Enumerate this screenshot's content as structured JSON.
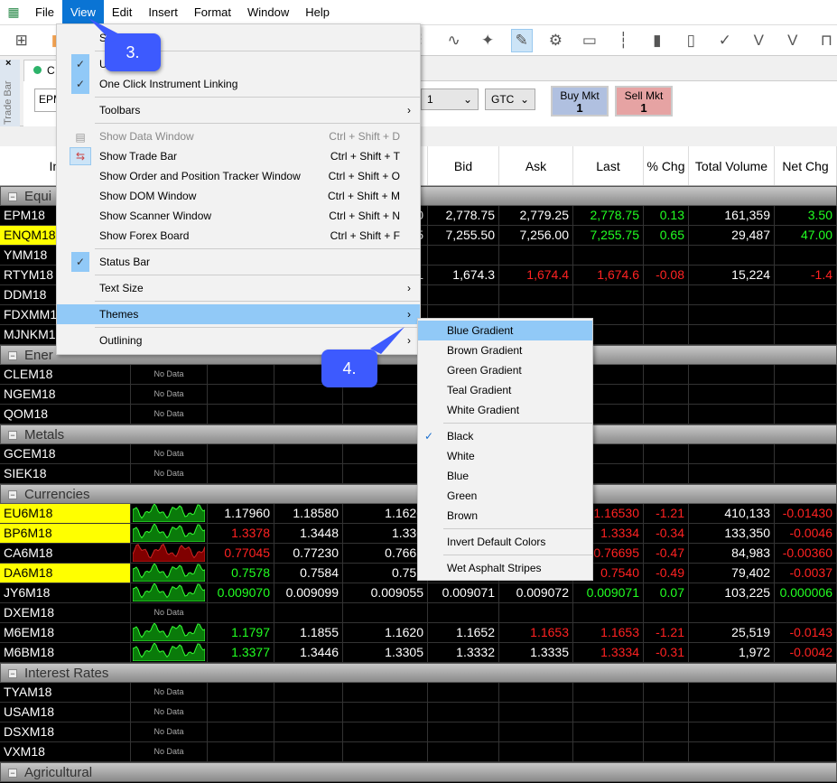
{
  "menubar": {
    "items": [
      "File",
      "View",
      "Edit",
      "Insert",
      "Format",
      "Window",
      "Help"
    ],
    "active": "View"
  },
  "tradebar": {
    "vertical_label": "Trade Bar",
    "tab_label": "C",
    "instrument": "EPM",
    "qty": "1",
    "tif": "GTC",
    "buy": {
      "label": "Buy Mkt",
      "qty": "1"
    },
    "sell": {
      "label": "Sell Mkt",
      "qty": "1"
    }
  },
  "columns": [
    "Instru",
    "",
    "",
    "",
    "",
    "Bid",
    "Ask",
    "Last",
    "% Chg",
    "Total Volume",
    "Net Chg"
  ],
  "groups": [
    {
      "name": "Equi",
      "rows": [
        {
          "n": "EPM18",
          "hl": false,
          "s": "",
          "c": [
            "",
            "",
            "0",
            "2,778.75",
            "2,779.25",
            "2,778.75",
            "0.13",
            "161,359",
            "3.50"
          ],
          "k": "wwwwwggwg"
        },
        {
          "n": "ENQM18",
          "hl": true,
          "s": "",
          "c": [
            "",
            "",
            "5",
            "7,255.50",
            "7,256.00",
            "7,255.75",
            "0.65",
            "29,487",
            "47.00"
          ],
          "k": "wwwwwggwg"
        },
        {
          "n": "YMM18",
          "hl": false,
          "s": "",
          "c": [
            "",
            "",
            "",
            "",
            "",
            "",
            "",
            "",
            ""
          ],
          "k": "wwwwwwwww"
        },
        {
          "n": "RTYM18",
          "hl": false,
          "s": "",
          "c": [
            "",
            "",
            "1",
            "1,674.3",
            "1,674.4",
            "1,674.6",
            "-0.08",
            "15,224",
            "-1.4"
          ],
          "k": "wwwwrrrwr"
        },
        {
          "n": "DDM18",
          "hl": false,
          "s": "",
          "c": [
            "",
            "",
            "",
            "",
            "",
            "",
            "",
            "",
            ""
          ],
          "k": "wwwwwwwww"
        },
        {
          "n": "FDXMM18",
          "hl": false,
          "s": "",
          "c": [
            "",
            "",
            "",
            "",
            "",
            "",
            "",
            "",
            ""
          ],
          "k": "wwwwwwwww"
        },
        {
          "n": "MJNKM18",
          "hl": false,
          "s": "",
          "c": [
            "",
            "",
            "",
            "",
            "",
            "",
            "",
            "",
            ""
          ],
          "k": "wwwwwwwww"
        }
      ]
    },
    {
      "name": "Ener",
      "rows": [
        {
          "n": "CLEM18",
          "hl": false,
          "s": "No Data",
          "c": [
            "",
            "",
            "",
            "",
            "",
            "",
            "",
            "",
            ""
          ],
          "k": "wwwwwwwww"
        },
        {
          "n": "NGEM18",
          "hl": false,
          "s": "No Data",
          "c": [
            "",
            "",
            "",
            "",
            "",
            "",
            "",
            "",
            ""
          ],
          "k": "wwwwwwwww"
        },
        {
          "n": "QOM18",
          "hl": false,
          "s": "No Data",
          "c": [
            "",
            "",
            "",
            "",
            "",
            "",
            "",
            "",
            ""
          ],
          "k": "wwwwwwwww"
        }
      ]
    },
    {
      "name": "Metals",
      "rows": [
        {
          "n": "GCEM18",
          "hl": false,
          "s": "No Data",
          "c": [
            "",
            "",
            "",
            "",
            "",
            "",
            "",
            "",
            ""
          ],
          "k": "wwwwwwwww"
        },
        {
          "n": "SIEK18",
          "hl": false,
          "s": "No Data",
          "c": [
            "",
            "",
            "",
            "",
            "",
            "",
            "",
            "",
            ""
          ],
          "k": "wwwwwwwww"
        }
      ]
    },
    {
      "name": "Currencies",
      "rows": [
        {
          "n": "EU6M18",
          "hl": true,
          "s": "green",
          "c": [
            "1.17960",
            "1.18580",
            "1.1620",
            "",
            "",
            "1.16530",
            "-1.21",
            "410,133",
            "-0.01430"
          ],
          "k": "wwwwwrrwr"
        },
        {
          "n": "BP6M18",
          "hl": true,
          "s": "green",
          "c": [
            "1.3378",
            "1.3448",
            "1.330",
            "",
            "",
            "1.3334",
            "-0.34",
            "133,350",
            "-0.0046"
          ],
          "k": "rwwwwrrwr"
        },
        {
          "n": "CA6M18",
          "hl": false,
          "s": "red",
          "c": [
            "0.77045",
            "0.77230",
            "0.7668",
            "",
            "",
            "0.76695",
            "-0.47",
            "84,983",
            "-0.00360"
          ],
          "k": "rwwwwrrwr"
        },
        {
          "n": "DA6M18",
          "hl": true,
          "s": "green",
          "c": [
            "0.7578",
            "0.7584",
            "0.752",
            "",
            "",
            "0.7540",
            "-0.49",
            "79,402",
            "-0.0037"
          ],
          "k": "gwwwwrrwr"
        },
        {
          "n": "JY6M18",
          "hl": false,
          "s": "green",
          "c": [
            "0.009070",
            "0.009099",
            "0.009055",
            "0.009071",
            "0.009072",
            "0.009071",
            "0.07",
            "103,225",
            "0.000006"
          ],
          "k": "gwwwwggwg"
        },
        {
          "n": "DXEM18",
          "hl": false,
          "s": "No Data",
          "c": [
            "",
            "",
            "",
            "",
            "",
            "",
            "",
            "",
            ""
          ],
          "k": "wwwwwwwww"
        },
        {
          "n": "M6EM18",
          "hl": false,
          "s": "green",
          "c": [
            "1.1797",
            "1.1855",
            "1.1620",
            "1.1652",
            "1.1653",
            "1.1653",
            "-1.21",
            "25,519",
            "-0.0143"
          ],
          "k": "gwwwrrrwr"
        },
        {
          "n": "M6BM18",
          "hl": false,
          "s": "green",
          "c": [
            "1.3377",
            "1.3446",
            "1.3305",
            "1.3332",
            "1.3335",
            "1.3334",
            "-0.31",
            "1,972",
            "-0.0042"
          ],
          "k": "gwwwwrrwr"
        }
      ]
    },
    {
      "name": "Interest Rates",
      "rows": [
        {
          "n": "TYAM18",
          "hl": false,
          "s": "No Data",
          "c": [
            "",
            "",
            "",
            "",
            "",
            "",
            "",
            "",
            ""
          ],
          "k": "wwwwwwwww"
        },
        {
          "n": "USAM18",
          "hl": false,
          "s": "No Data",
          "c": [
            "",
            "",
            "",
            "",
            "",
            "",
            "",
            "",
            ""
          ],
          "k": "wwwwwwwww"
        },
        {
          "n": "DSXM18",
          "hl": false,
          "s": "No Data",
          "c": [
            "",
            "",
            "",
            "",
            "",
            "",
            "",
            "",
            ""
          ],
          "k": "wwwwwwwww"
        },
        {
          "n": "VXM18",
          "hl": false,
          "s": "No Data",
          "c": [
            "",
            "",
            "",
            "",
            "",
            "",
            "",
            "",
            ""
          ],
          "k": "wwwwwwwww"
        }
      ]
    },
    {
      "name": "Agricultural",
      "rows": []
    }
  ],
  "view_menu": [
    {
      "label": "S",
      "sep_after": true
    },
    {
      "label": "Up           ation",
      "check": true
    },
    {
      "label": "One Click Instrument Linking",
      "check": true,
      "sep_after": true
    },
    {
      "label": "Toolbars",
      "sub": true,
      "sep_after": true
    },
    {
      "label": "Show Data Window",
      "sc": "Ctrl + Shift + D",
      "dis": true,
      "icon": "data-window"
    },
    {
      "label": "Show Trade Bar",
      "sc": "Ctrl + Shift + T",
      "icon": "trade-bar"
    },
    {
      "label": "Show Order and Position Tracker Window",
      "sc": "Ctrl + Shift + O"
    },
    {
      "label": "Show DOM Window",
      "sc": "Ctrl + Shift + M"
    },
    {
      "label": "Show Scanner Window",
      "sc": "Ctrl + Shift + N"
    },
    {
      "label": "Show Forex Board",
      "sc": "Ctrl + Shift + F",
      "sep_after": true
    },
    {
      "label": "Status Bar",
      "check": true,
      "sep_after": true
    },
    {
      "label": "Text Size",
      "sub": true,
      "sep_after": true
    },
    {
      "label": "Themes",
      "sub": true,
      "hot": true,
      "sep_after": true
    },
    {
      "label": "Outlining",
      "sub": true
    }
  ],
  "themes_menu": [
    {
      "label": "Blue Gradient",
      "hot": true
    },
    {
      "label": "Brown Gradient"
    },
    {
      "label": "Green Gradient"
    },
    {
      "label": "Teal Gradient"
    },
    {
      "label": "White Gradient",
      "sep_after": true
    },
    {
      "label": "Black",
      "check": true
    },
    {
      "label": "White"
    },
    {
      "label": "Blue"
    },
    {
      "label": "Green"
    },
    {
      "label": "Brown",
      "sep_after": true
    },
    {
      "label": "Invert Default Colors",
      "sep_after": true
    },
    {
      "label": "Wet Asphalt Stripes"
    }
  ],
  "callouts": [
    "3.",
    "4."
  ],
  "colors": {
    "accent": "#0a74d4",
    "callout": "#3d5afe",
    "highlight": "#91c9f7",
    "up": "#22ff22",
    "down": "#ff2222",
    "flag": "#ffff00"
  }
}
